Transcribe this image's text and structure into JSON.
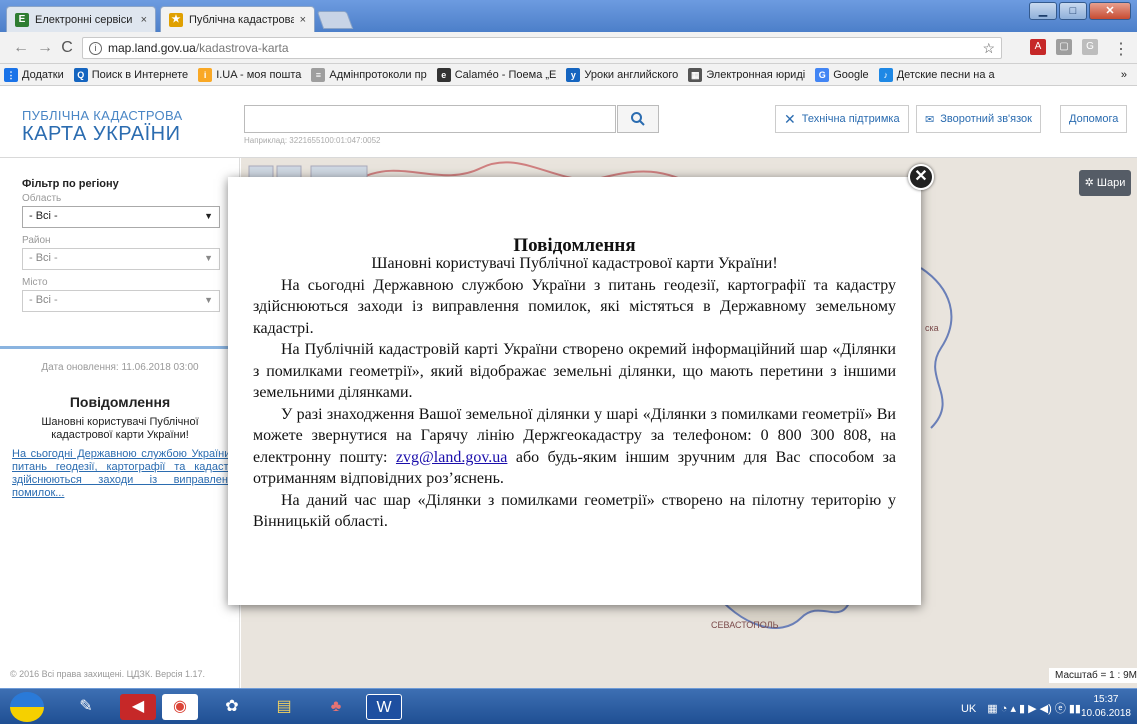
{
  "browser": {
    "tabs": [
      {
        "label": "Електронні сервіси ДЗК",
        "favicon": "E",
        "favicon_color": "#2e7d32"
      },
      {
        "label": "Публічна кадастрова ка",
        "favicon": "★",
        "favicon_color": "#e0a000"
      }
    ],
    "tab_close": "×",
    "window_buttons": [
      "▁",
      "□",
      "✕"
    ],
    "url_host": "map.land.gov.ua",
    "url_path": "/kadastrova-karta",
    "bookmarks": [
      {
        "label": "Додатки",
        "icon": "apps-icon",
        "color": "#1a73e8",
        "glyph": "⋮⋮"
      },
      {
        "label": "Поиск в Интернете",
        "icon": "search-icon",
        "color": "#1565c0",
        "glyph": "Q"
      },
      {
        "label": "I.UA - моя пошта",
        "icon": "mail-icon",
        "color": "#f9a825",
        "glyph": "i"
      },
      {
        "label": "Адмінпротоколи пр",
        "icon": "document-icon",
        "color": "#9e9e9e",
        "glyph": "≡"
      },
      {
        "label": "Calaméo - Поема „Е",
        "icon": "book-icon",
        "color": "#333333",
        "glyph": "e"
      },
      {
        "label": "Уроки английского",
        "icon": "lesson-icon",
        "color": "#1565c0",
        "glyph": "y"
      },
      {
        "label": "Электронная юриді",
        "icon": "law-icon",
        "color": "#555555",
        "glyph": "▦"
      },
      {
        "label": "Google",
        "icon": "google-icon",
        "color": "#4285f4",
        "glyph": "G"
      },
      {
        "label": "Детские песни на а",
        "icon": "music-icon",
        "color": "#1e88e5",
        "glyph": "♪"
      }
    ],
    "bookmarks_more": "»"
  },
  "header": {
    "brand_line1": "ПУБЛІЧНА КАДАСТРОВА",
    "brand_line2": "КАРТА УКРАЇНИ",
    "search_placeholder": "",
    "search_hint": "Наприклад: 3221655100:01:047:0052",
    "support_label": "Технічна підтримка",
    "feedback_label": "Зворотний зв'язок",
    "help_label": "Допомога"
  },
  "sidebar": {
    "filter_title": "Фільтр по регіону",
    "oblast_label": "Область",
    "oblast_value": "- Всі -",
    "raion_label": "Район",
    "raion_value": "- Всі -",
    "misto_label": "Місто",
    "misto_value": "- Всі -",
    "update_date": "Дата оновлення: 11.06.2018 03:00",
    "notice_title": "Повідомлення",
    "notice_greeting": "Шановні користувачі Публічної кадастрової карти України!",
    "notice_link": "На сьогодні Державною службою України з питань геодезії, картографії та кадастру здійснюються заходи із виправлення помилок...",
    "copyright": "© 2016 Всі права захищені. ЦДЗК. Версія 1.17."
  },
  "map": {
    "layers_label": "Шари",
    "scale_label": "Масштаб = 1 : 9M",
    "place_label": "СЕВАСТОПОЛЬ",
    "side_label": "ска"
  },
  "modal": {
    "title": "Повідомлення",
    "greeting": "Шановні користувачі Публічної кадастрової карти України!",
    "p1": "На сьогодні Державною службою України з питань геодезії, картографії та кадастру здійснюються заходи із виправлення помилок, які містяться в Державному земельному кадастрі.",
    "p2": "На Публічній кадастровій карті України створено окремий інформаційний шар «Ділянки з помилками геометрії», який відображає земельні ділянки, що мають перетини з іншими земельними ділянками.",
    "p3_a": "У разі знаходження Вашої земельної ділянки у шарі «Ділянки з помилками геометрії» Ви можете звернутися на Гарячу лінію Держгеокадастру за телефоном: 0 800 300 808, на електронну пошту: ",
    "p3_email": "zvg@land.gov.ua",
    "p3_b": " або будь-яким іншим зручним для Вас способом за отриманням відповідних роз’яснень.",
    "p4": "На даний час шар «Ділянки з помилками геометрії» створено на пілотну територію у Вінницькій області.",
    "close_glyph": "✕"
  },
  "taskbar": {
    "tray_text": "UK",
    "time": "15:37",
    "date": "10.06.2018"
  }
}
